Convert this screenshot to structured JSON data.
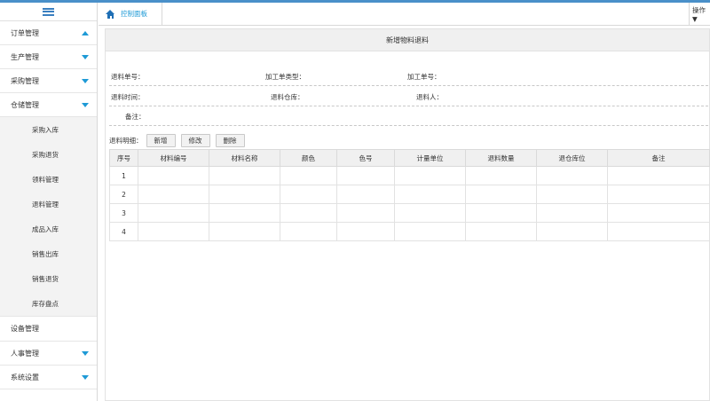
{
  "sidebar": {
    "items": [
      {
        "label": "订单管理"
      },
      {
        "label": "生产管理"
      },
      {
        "label": "采购管理"
      },
      {
        "label": "仓储管理",
        "children": [
          "采购入库",
          "采购退货",
          "领料管理",
          "退料管理",
          "成品入库",
          "销售出库",
          "销售退货",
          "库存盘点"
        ]
      },
      {
        "label": "设备管理"
      },
      {
        "label": "人事管理"
      },
      {
        "label": "系统设置"
      }
    ]
  },
  "tabs": {
    "home_label": "控制面板",
    "ops_label": "操作 ▼"
  },
  "panel": {
    "title": "新增物料退料",
    "fields": {
      "return_no": "退料单号：",
      "process_type": "加工单类型：",
      "process_no": "加工单号：",
      "return_time": "退料时间：",
      "return_warehouse": "退料仓库：",
      "returner": "退料人：",
      "remark": "备注："
    },
    "detail_label": "退料明细：",
    "buttons": {
      "add": "新增",
      "edit": "修改",
      "delete": "删除"
    }
  },
  "table": {
    "headers": [
      "序号",
      "材料编号",
      "材料名称",
      "颜色",
      "色号",
      "计量单位",
      "退料数量",
      "退仓库位",
      "备注"
    ],
    "rows": [
      {
        "no": "1"
      },
      {
        "no": "2"
      },
      {
        "no": "3"
      },
      {
        "no": "4"
      }
    ]
  },
  "colors": {
    "accent": "#1e9ad6",
    "topbar": "#4a90c9"
  }
}
